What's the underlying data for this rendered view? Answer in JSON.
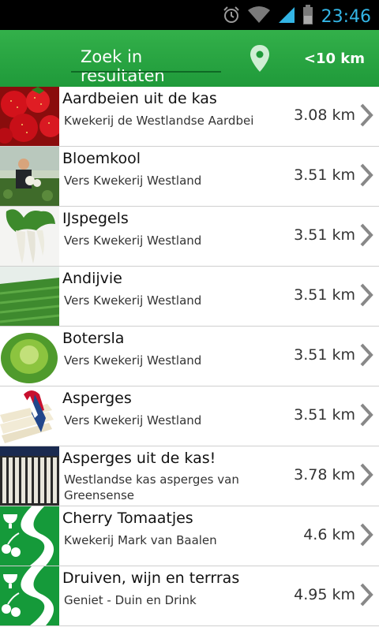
{
  "status": {
    "time": "23:46"
  },
  "header": {
    "search_label": "Zoek in resultaten",
    "distance_filter": "<10 km"
  },
  "colors": {
    "accent": "#1f9a3a",
    "time": "#33b5e5"
  },
  "items": [
    {
      "title": "Aardbeien uit de kas",
      "subtitle": "Kwekerij de Westlandse Aardbei",
      "distance": "3.08 km",
      "thumb": "strawberries"
    },
    {
      "title": "Bloemkool",
      "subtitle": "Vers Kwekerij Westland",
      "distance": "3.51 km",
      "thumb": "cauliflower-farmer"
    },
    {
      "title": "IJspegels",
      "subtitle": "Vers Kwekerij Westland",
      "distance": "3.51 km",
      "thumb": "white-radish"
    },
    {
      "title": "Andijvie",
      "subtitle": "Vers Kwekerij Westland",
      "distance": "3.51 km",
      "thumb": "greenhouse-field"
    },
    {
      "title": "Botersla",
      "subtitle": "Vers Kwekerij Westland",
      "distance": "3.51 km",
      "thumb": "lettuce"
    },
    {
      "title": "Asperges",
      "subtitle": "Vers Kwekerij Westland",
      "distance": "3.51 km",
      "thumb": "asparagus-bundle"
    },
    {
      "title": "Asperges uit de kas!",
      "subtitle": "Westlandse kas asperges van Greensense",
      "distance": "3.78 km",
      "thumb": "asparagus-crate"
    },
    {
      "title": "Cherry Tomaatjes",
      "subtitle": "Kwekerij Mark van Baalen",
      "distance": "4.6 km",
      "thumb": "route-logo"
    },
    {
      "title": "Druiven, wijn en terrras",
      "subtitle": "Geniet - Duin en Drink",
      "distance": "4.95 km",
      "thumb": "route-logo"
    }
  ]
}
